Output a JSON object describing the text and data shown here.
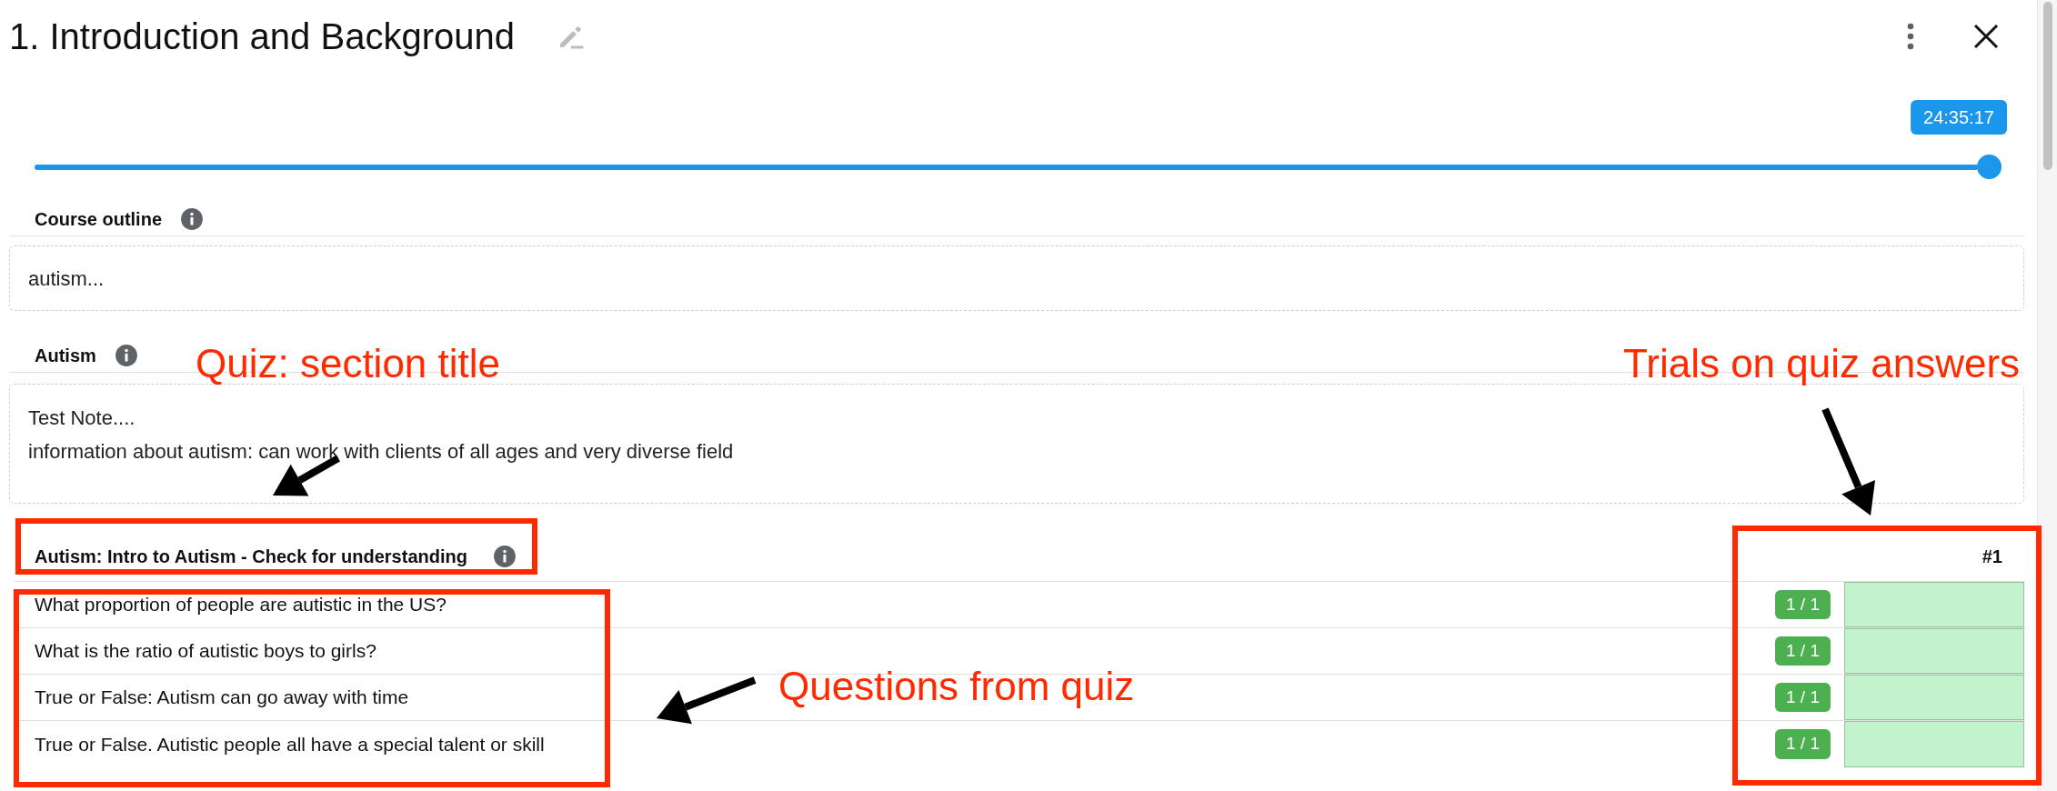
{
  "header": {
    "title": "1. Introduction and Background"
  },
  "slider": {
    "level": 1,
    "tooltip": "24:35:17"
  },
  "notes": [
    {
      "label": "Course outline",
      "lines": [
        "autism..."
      ]
    },
    {
      "label": "Autism",
      "lines": [
        "Test Note....",
        "information about autism: can work with clients of all ages and very diverse field"
      ]
    }
  ],
  "quiz": {
    "title": "Autism: Intro to Autism - Check for understanding",
    "trial_column": "#1",
    "rows": [
      {
        "question": "What proportion of people are autistic in the US?",
        "score": "1 / 1"
      },
      {
        "question": "What is the ratio of autistic boys to girls?",
        "score": "1 / 1"
      },
      {
        "question": "True or False: Autism can go away with time",
        "score": "1 / 1"
      },
      {
        "question": "True or False. Autistic people all have a special talent or skill",
        "score": "1 / 1"
      }
    ]
  },
  "annotations": [
    "Quiz: section title",
    "Trials on quiz answers",
    "Questions from quiz"
  ]
}
